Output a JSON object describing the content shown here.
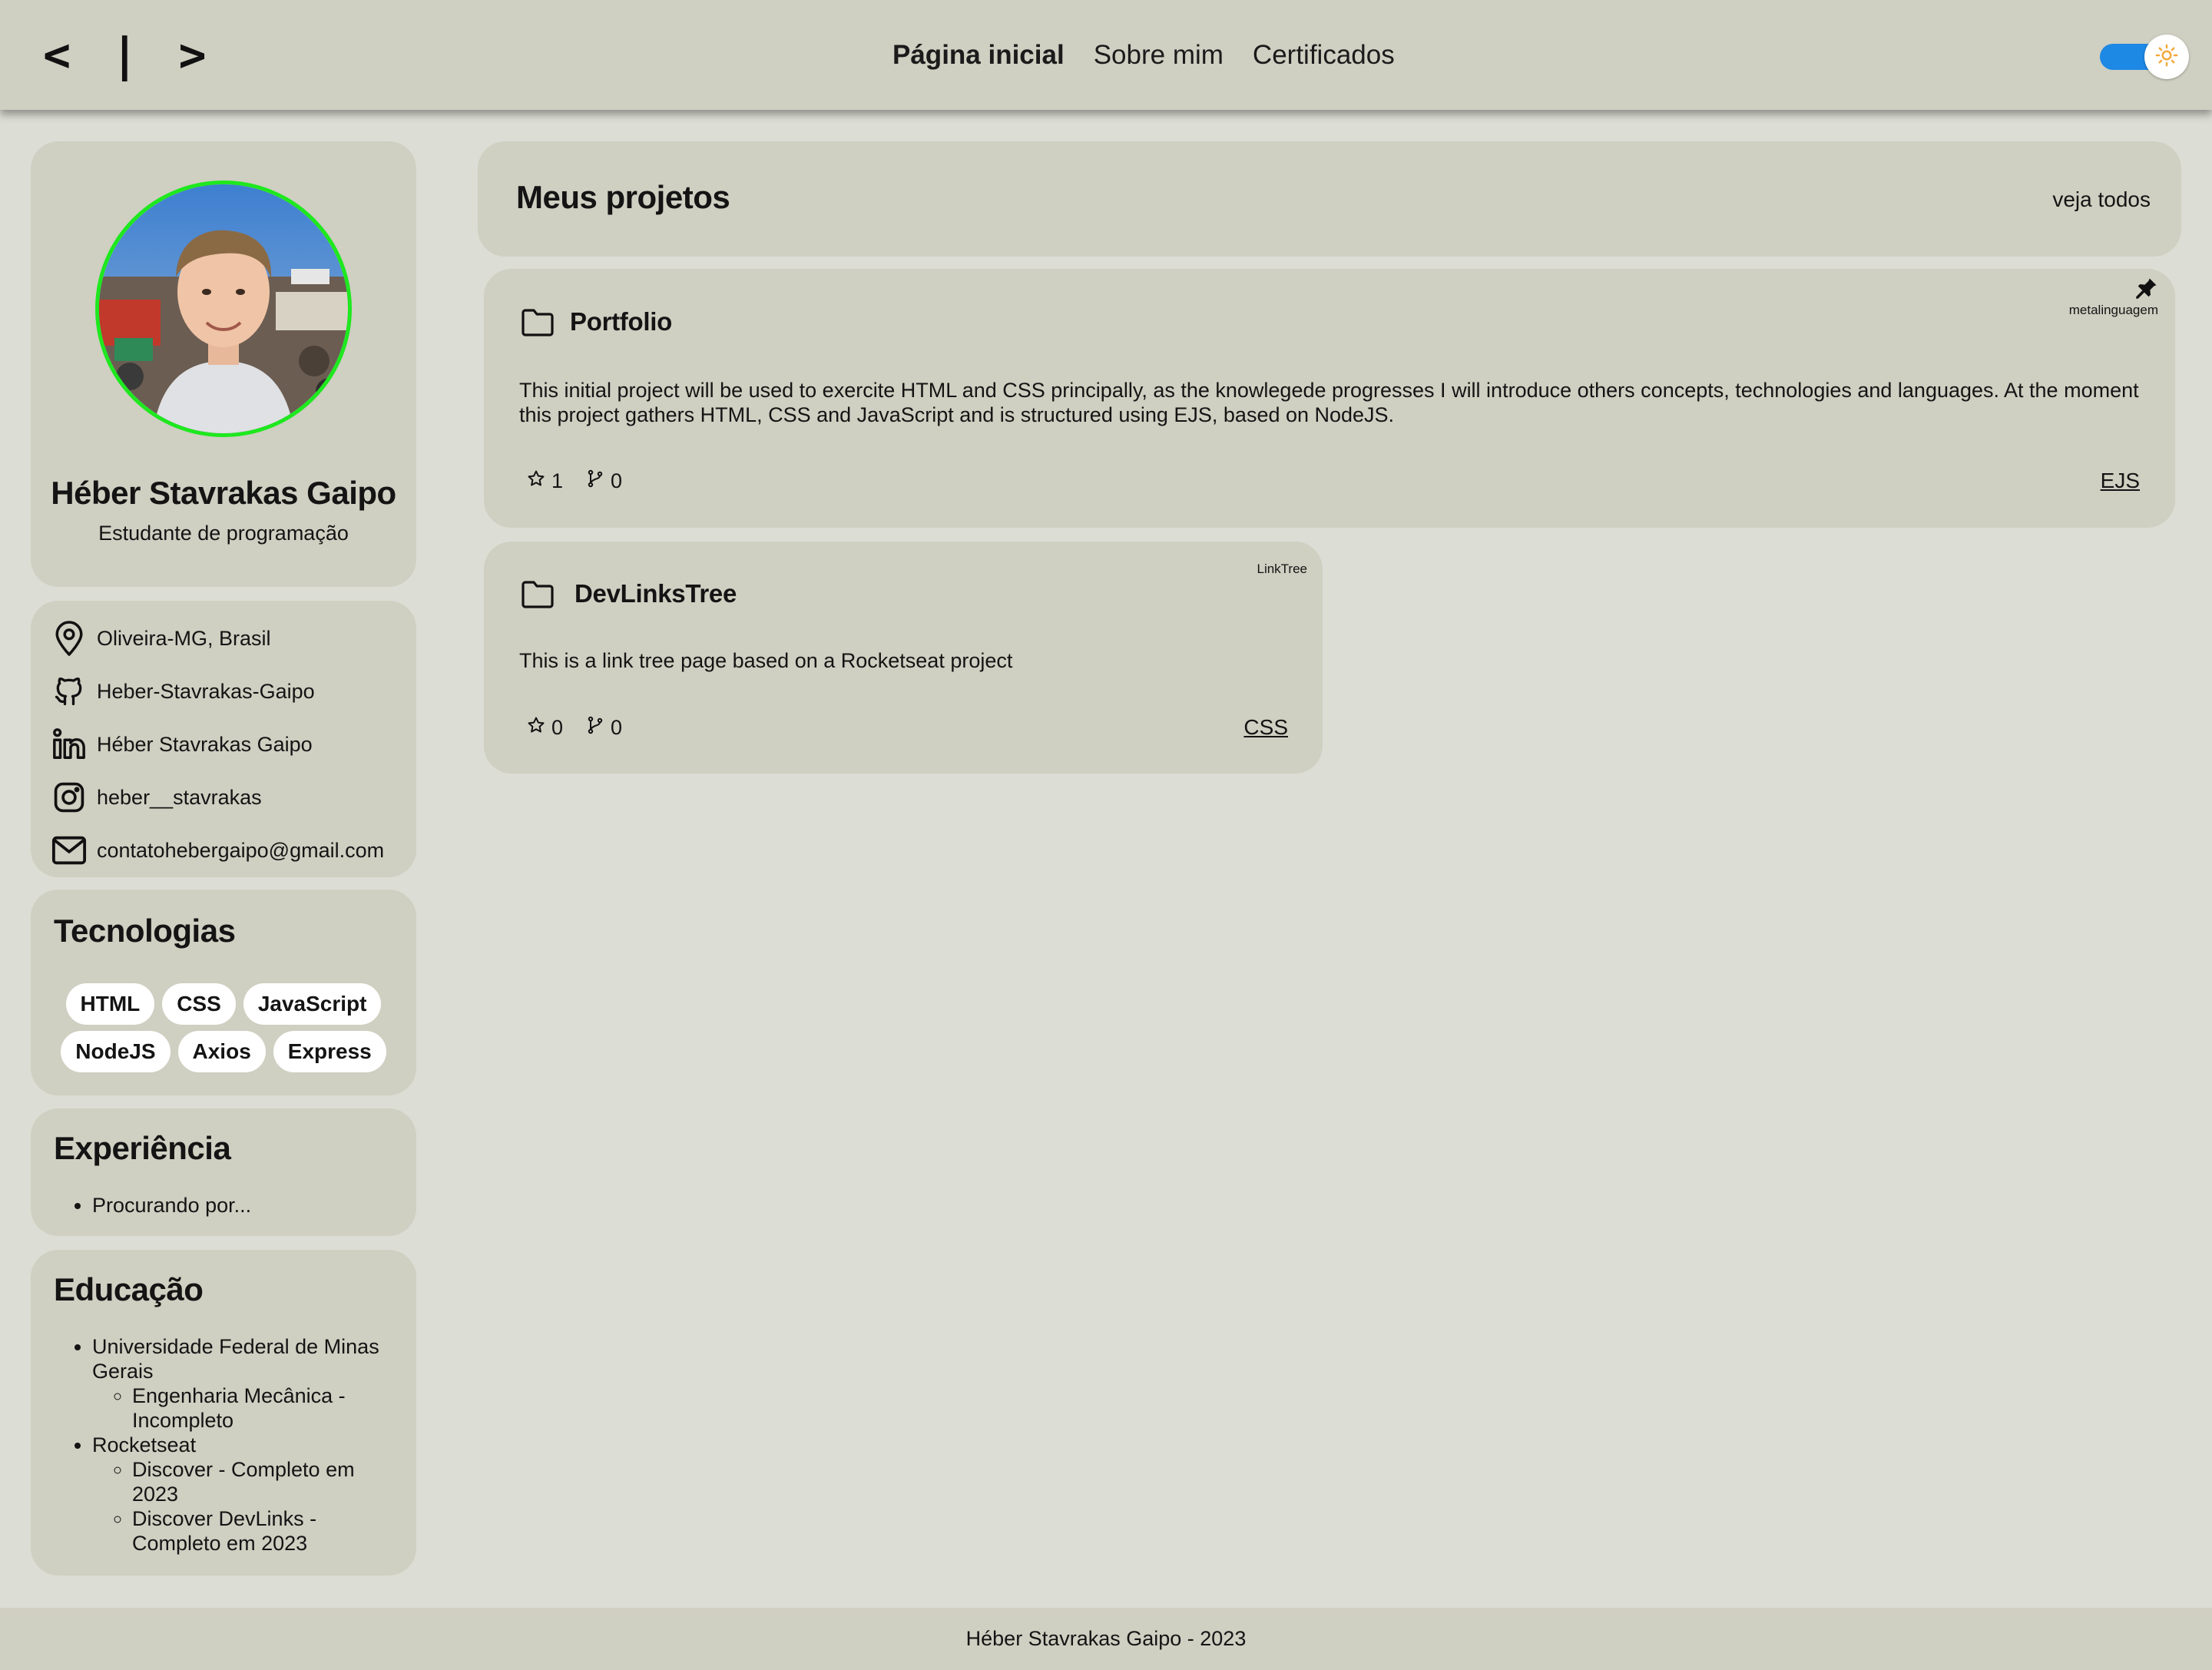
{
  "header": {
    "logo": "< | >",
    "nav": [
      "Página inicial",
      "Sobre mim",
      "Certificados"
    ],
    "theme_toggle_icon": "sun-icon"
  },
  "profile": {
    "name": "Héber Stavrakas Gaipo",
    "role": "Estudante de programação"
  },
  "contacts": [
    {
      "icon": "location-pin-icon",
      "text": "Oliveira-MG, Brasil"
    },
    {
      "icon": "github-icon",
      "text": "Heber-Stavrakas-Gaipo"
    },
    {
      "icon": "linkedin-icon",
      "text": "Héber Stavrakas Gaipo"
    },
    {
      "icon": "instagram-icon",
      "text": "heber__stavrakas"
    },
    {
      "icon": "mail-icon",
      "text": "contatohebergaipo@gmail.com"
    }
  ],
  "technologies": {
    "title": "Tecnologias",
    "items": [
      "HTML",
      "CSS",
      "JavaScript",
      "NodeJS",
      "Axios",
      "Express"
    ]
  },
  "experience": {
    "title": "Experiência",
    "items": [
      "Procurando por..."
    ]
  },
  "education": {
    "title": "Educação",
    "items": [
      {
        "name": "Universidade Federal de Minas Gerais",
        "sub": [
          "Engenharia Mecânica - Incompleto"
        ]
      },
      {
        "name": "Rocketseat",
        "sub": [
          "Discover - Completo em 2023",
          "Discover DevLinks - Completo em 2023"
        ]
      }
    ]
  },
  "projects": {
    "title": "Meus projetos",
    "see_all": "veja todos",
    "repos": [
      {
        "name": "Portfolio",
        "tag": "metalinguagem",
        "pinned": true,
        "description": "This initial project will be used to exercite HTML and CSS principally, as the knowlegede progresses I will introduce others concepts, technologies and languages. At the moment this project gathers HTML, CSS and JavaScript and is structured using EJS, based on NodeJS.",
        "stars": "1",
        "forks": "0",
        "language": "EJS"
      },
      {
        "name": "DevLinksTree",
        "tag": "LinkTree",
        "pinned": false,
        "description": "This is a link tree page based on a Rocketseat project",
        "stars": "0",
        "forks": "0",
        "language": "CSS"
      }
    ]
  },
  "footer": {
    "text": "Héber Stavrakas Gaipo - 2023"
  },
  "colors": {
    "background": "#dcddd4",
    "card": "#cfcfc2",
    "toggle": "#1e88e5",
    "avatar_border": "#1ee81e",
    "sun": "#f2a93b"
  }
}
